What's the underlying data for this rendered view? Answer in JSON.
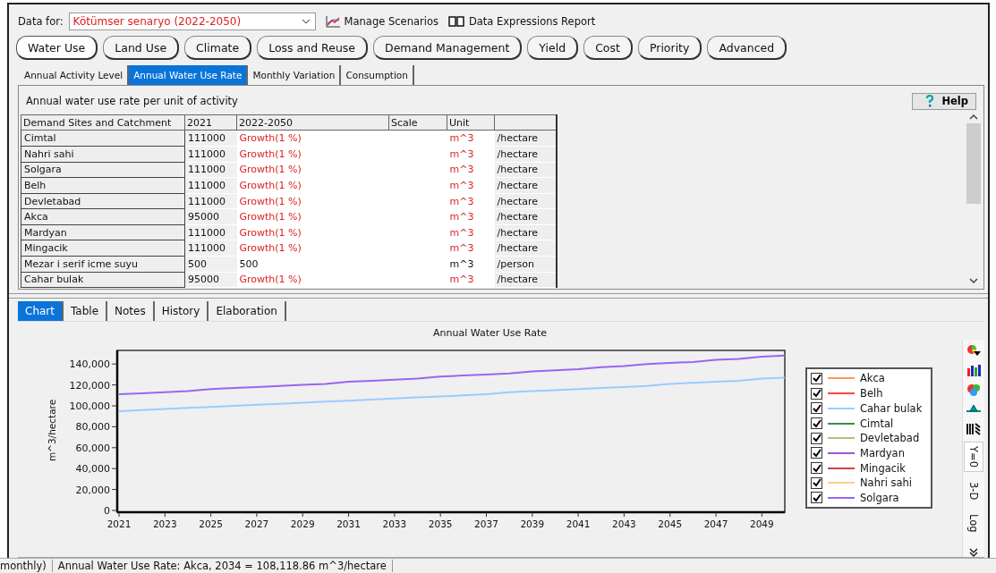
{
  "top_bar": {
    "label": "Data for:",
    "scenario": "Kötümser senaryo (2022-2050)",
    "links": [
      {
        "label": "Manage Scenarios",
        "kind": "scenarios"
      },
      {
        "label": "Data Expressions Report",
        "kind": "report"
      }
    ]
  },
  "categories": [
    {
      "label": "Water Use",
      "selected": true
    },
    {
      "label": "Land Use",
      "selected": false
    },
    {
      "label": "Climate",
      "selected": false
    },
    {
      "label": "Loss and Reuse",
      "selected": false
    },
    {
      "label": "Demand Management",
      "selected": false
    },
    {
      "label": "Yield",
      "selected": false
    },
    {
      "label": "Cost",
      "selected": false
    },
    {
      "label": "Priority",
      "selected": false
    },
    {
      "label": "Advanced",
      "selected": false
    }
  ],
  "sub_tabs": [
    {
      "label": "Annual Activity Level",
      "selected": false
    },
    {
      "label": "Annual Water Use Rate",
      "selected": true
    },
    {
      "label": "Monthly Variation",
      "selected": false
    },
    {
      "label": "Consumption",
      "selected": false
    }
  ],
  "panel": {
    "description": "Annual water use rate per unit of activity",
    "help_button": "Help"
  },
  "table": {
    "columns": [
      "Demand Sites and Catchment",
      "2021",
      "2022-2050",
      "Scale",
      "Unit"
    ],
    "rows": [
      {
        "name": "Cimtal",
        "base": "111000",
        "expression": "Growth(1 %)",
        "unit": "m^3",
        "per": "/hectare",
        "is_expression": true
      },
      {
        "name": "Nahri sahi",
        "base": "111000",
        "expression": "Growth(1 %)",
        "unit": "m^3",
        "per": "/hectare",
        "is_expression": true
      },
      {
        "name": "Solgara",
        "base": "111000",
        "expression": "Growth(1 %)",
        "unit": "m^3",
        "per": "/hectare",
        "is_expression": true
      },
      {
        "name": "Belh",
        "base": "111000",
        "expression": "Growth(1 %)",
        "unit": "m^3",
        "per": "/hectare",
        "is_expression": true
      },
      {
        "name": "Devletabad",
        "base": "111000",
        "expression": "Growth(1 %)",
        "unit": "m^3",
        "per": "/hectare",
        "is_expression": true
      },
      {
        "name": "Akca",
        "base": "95000",
        "expression": "Growth(1 %)",
        "unit": "m^3",
        "per": "/hectare",
        "is_expression": true
      },
      {
        "name": "Mardyan",
        "base": "111000",
        "expression": "Growth(1 %)",
        "unit": "m^3",
        "per": "/hectare",
        "is_expression": true
      },
      {
        "name": "Mingacik",
        "base": "111000",
        "expression": "Growth(1 %)",
        "unit": "m^3",
        "per": "/hectare",
        "is_expression": true
      },
      {
        "name": "Mezar i serif icme suyu",
        "base": "500",
        "expression": "500",
        "unit": "m^3",
        "per": "/person",
        "is_expression": false
      },
      {
        "name": "Cahar bulak",
        "base": "95000",
        "expression": "Growth(1 %)",
        "unit": "m^3",
        "per": "/hectare",
        "is_expression": true
      }
    ]
  },
  "view_tabs": [
    {
      "label": "Chart",
      "selected": true
    },
    {
      "label": "Table",
      "selected": false
    },
    {
      "label": "Notes",
      "selected": false
    },
    {
      "label": "History",
      "selected": false
    },
    {
      "label": "Elaboration",
      "selected": false
    }
  ],
  "chart": {
    "toggles": [
      {
        "label": "Y=0",
        "selected": true
      },
      {
        "label": "3-D",
        "selected": false
      },
      {
        "label": "Log",
        "selected": false
      }
    ],
    "chart_data": {
      "type": "line",
      "title": "Annual Water Use Rate",
      "ylabel": "m^3/hectare",
      "x": [
        2021,
        2022,
        2023,
        2024,
        2025,
        2026,
        2027,
        2028,
        2029,
        2030,
        2031,
        2032,
        2033,
        2034,
        2035,
        2036,
        2037,
        2038,
        2039,
        2040,
        2041,
        2042,
        2043,
        2044,
        2045,
        2046,
        2047,
        2048,
        2049,
        2050
      ],
      "xlim": [
        2021,
        2050
      ],
      "ylim": [
        0,
        153000
      ],
      "xticks": [
        2021,
        2023,
        2025,
        2027,
        2029,
        2031,
        2033,
        2035,
        2037,
        2039,
        2041,
        2043,
        2045,
        2047,
        2049
      ],
      "yticks": [
        {
          "value": 0,
          "label": "0"
        },
        {
          "value": 20000,
          "label": "20,000"
        },
        {
          "value": 40000,
          "label": "40,000"
        },
        {
          "value": 60000,
          "label": "60,000"
        },
        {
          "value": 80000,
          "label": "80,000"
        },
        {
          "value": 100000,
          "label": "100,000"
        },
        {
          "value": 120000,
          "label": "120,000"
        },
        {
          "value": 140000,
          "label": "140,000"
        }
      ],
      "series": [
        {
          "name": "Akca",
          "color": "#ff9955",
          "values": [
            null,
            null,
            null,
            null,
            null,
            null,
            null,
            null,
            null,
            null,
            null,
            null,
            null,
            null,
            null,
            null,
            null,
            null,
            null,
            null,
            null,
            null,
            null,
            null,
            null,
            null,
            null,
            null,
            null,
            null
          ]
        },
        {
          "name": "Belh",
          "color": "#ff4444",
          "values": [
            null,
            null,
            null,
            null,
            null,
            null,
            null,
            null,
            null,
            null,
            null,
            null,
            null,
            null,
            null,
            null,
            null,
            null,
            null,
            null,
            null,
            null,
            null,
            null,
            null,
            null,
            null,
            null,
            null,
            null
          ]
        },
        {
          "name": "Cahar bulak",
          "color": "#99ccff",
          "values": [
            95000,
            96000,
            97000,
            98000,
            99000,
            100000,
            101000,
            102000,
            103000,
            104000,
            105000,
            106000,
            107000,
            108000,
            109000,
            110000,
            111000,
            113000,
            114000,
            115000,
            116000,
            117000,
            118000,
            119000,
            121000,
            122000,
            123000,
            124000,
            126000,
            127000
          ]
        },
        {
          "name": "Cimtal",
          "color": "#448844",
          "values": [
            null,
            null,
            null,
            null,
            null,
            null,
            null,
            null,
            null,
            null,
            null,
            null,
            null,
            null,
            null,
            null,
            null,
            null,
            null,
            null,
            null,
            null,
            null,
            null,
            null,
            null,
            null,
            null,
            null,
            null
          ]
        },
        {
          "name": "Devletabad",
          "color": "#bbbb77",
          "values": [
            null,
            null,
            null,
            null,
            null,
            null,
            null,
            null,
            null,
            null,
            null,
            null,
            null,
            null,
            null,
            null,
            null,
            null,
            null,
            null,
            null,
            null,
            null,
            null,
            null,
            null,
            null,
            null,
            null,
            null
          ]
        },
        {
          "name": "Mardyan",
          "color": "#9955cc",
          "values": [
            null,
            null,
            null,
            null,
            null,
            null,
            null,
            null,
            null,
            null,
            null,
            null,
            null,
            null,
            null,
            null,
            null,
            null,
            null,
            null,
            null,
            null,
            null,
            null,
            null,
            null,
            null,
            null,
            null,
            null
          ]
        },
        {
          "name": "Mingacik",
          "color": "#cc4444",
          "values": [
            null,
            null,
            null,
            null,
            null,
            null,
            null,
            null,
            null,
            null,
            null,
            null,
            null,
            null,
            null,
            null,
            null,
            null,
            null,
            null,
            null,
            null,
            null,
            null,
            null,
            null,
            null,
            null,
            null,
            null
          ]
        },
        {
          "name": "Nahri sahi",
          "color": "#ffcc88",
          "values": [
            null,
            null,
            null,
            null,
            null,
            null,
            null,
            null,
            null,
            null,
            null,
            null,
            null,
            null,
            null,
            null,
            null,
            null,
            null,
            null,
            null,
            null,
            null,
            null,
            null,
            null,
            null,
            null,
            null,
            null
          ]
        },
        {
          "name": "Solgara",
          "color": "#9966ee",
          "values": [
            111000,
            112000,
            113000,
            114000,
            116000,
            117000,
            118000,
            119000,
            120000,
            121000,
            123000,
            124000,
            125000,
            126000,
            128000,
            129000,
            130000,
            131000,
            133000,
            134000,
            135000,
            137000,
            138000,
            140000,
            141000,
            142000,
            144000,
            145000,
            147000,
            148000
          ]
        }
      ]
    },
    "legend": [
      {
        "checked": true
      },
      {
        "checked": true
      },
      {
        "checked": true
      },
      {
        "checked": true
      },
      {
        "checked": true
      },
      {
        "checked": true
      },
      {
        "checked": true
      },
      {
        "checked": true
      },
      {
        "checked": true
      }
    ]
  },
  "status_bar": [
    "monthly)",
    "Annual Water Use Rate: Akca, 2034 = 108,118.86 m^3/hectare"
  ]
}
